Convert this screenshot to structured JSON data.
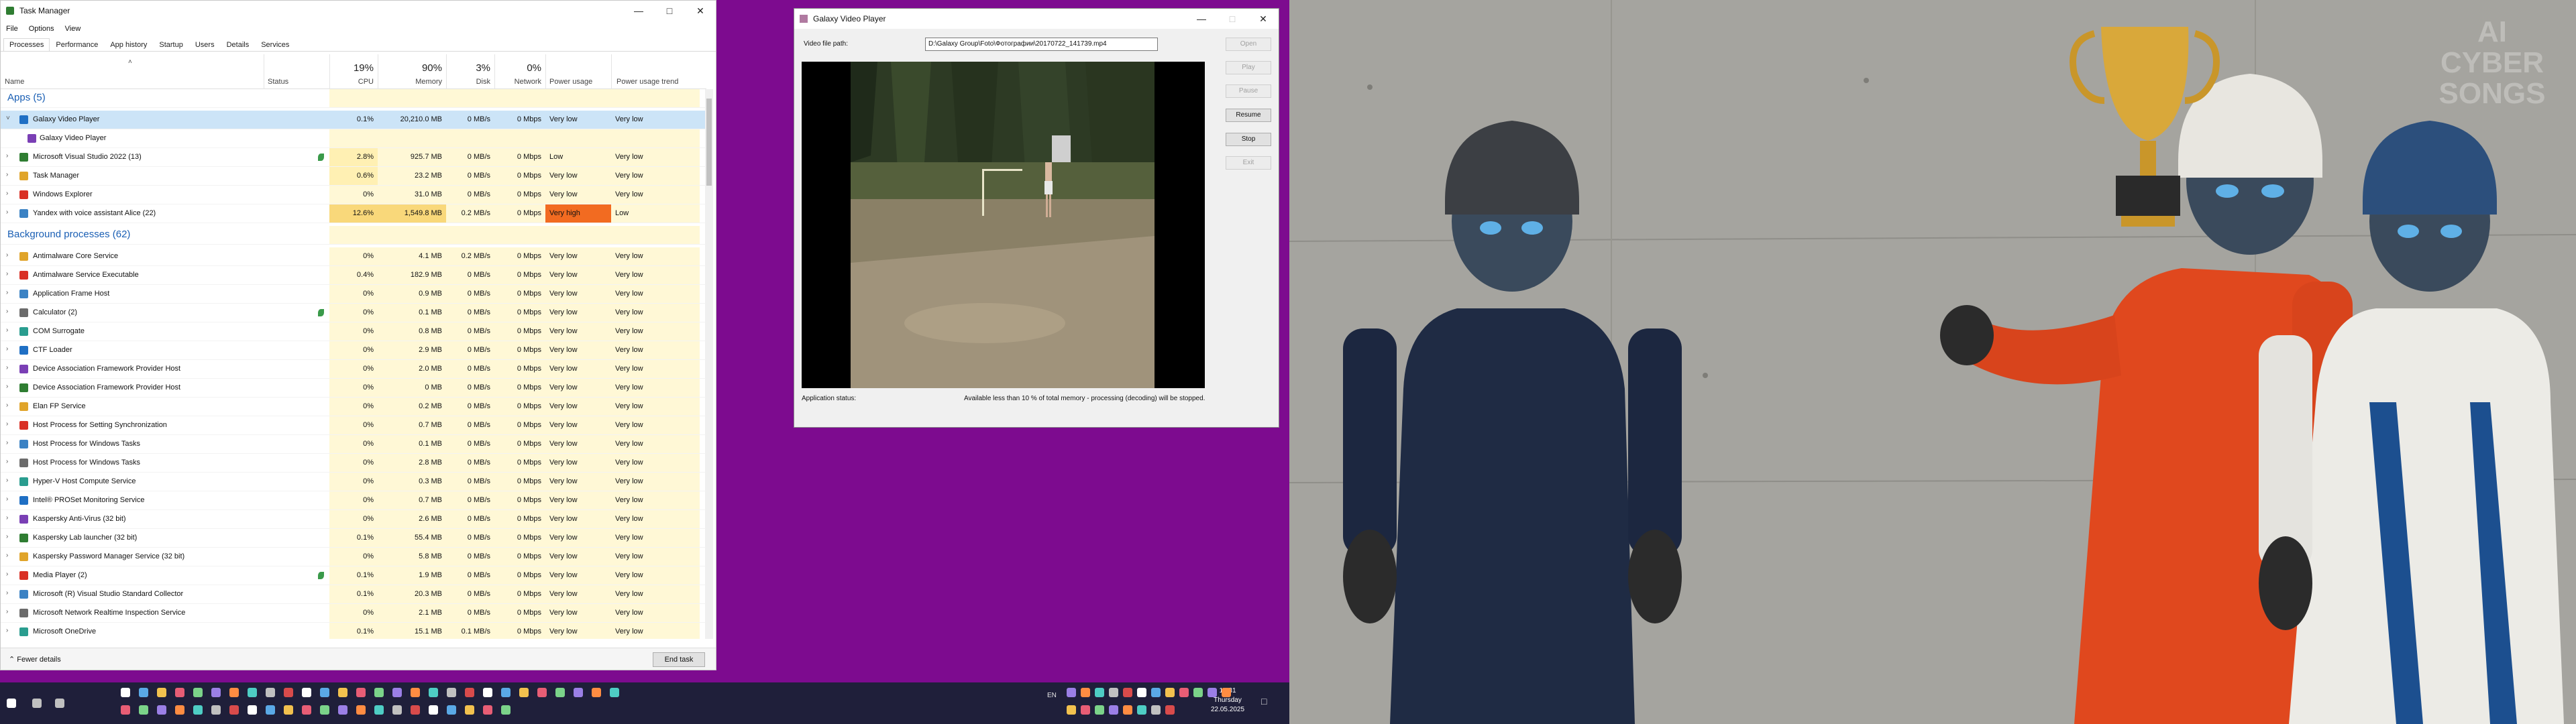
{
  "taskmanager": {
    "title": "Task Manager",
    "menu": [
      "File",
      "Options",
      "View"
    ],
    "tabs": [
      "Processes",
      "Performance",
      "App history",
      "Startup",
      "Users",
      "Details",
      "Services"
    ],
    "columns": {
      "name": "Name",
      "status": "Status",
      "cpu": "CPU",
      "memory": "Memory",
      "disk": "Disk",
      "network": "Network",
      "power": "Power usage",
      "power_trend": "Power usage trend"
    },
    "totals": {
      "cpu": "19%",
      "memory": "90%",
      "disk": "3%",
      "network": "0%"
    },
    "sections": {
      "apps": "Apps (5)",
      "background": "Background processes (62)"
    },
    "apps": [
      {
        "name": "Galaxy Video Player",
        "cpu": "0.1%",
        "memory": "20,210.0 MB",
        "disk": "0 MB/s",
        "network": "0 Mbps",
        "power": "Very low",
        "trend": "Very low"
      },
      {
        "name": "Galaxy Video Player"
      },
      {
        "name": "Microsoft Visual Studio 2022 (13)",
        "cpu": "2.8%",
        "memory": "925.7 MB",
        "disk": "0 MB/s",
        "network": "0 Mbps",
        "power": "Low",
        "trend": "Very low"
      },
      {
        "name": "Task Manager",
        "cpu": "0.6%",
        "memory": "23.2 MB",
        "disk": "0 MB/s",
        "network": "0 Mbps",
        "power": "Very low",
        "trend": "Very low"
      },
      {
        "name": "Windows Explorer",
        "cpu": "0%",
        "memory": "31.0 MB",
        "disk": "0 MB/s",
        "network": "0 Mbps",
        "power": "Very low",
        "trend": "Very low"
      },
      {
        "name": "Yandex with voice assistant Alice (22)",
        "cpu": "12.6%",
        "memory": "1,549.8 MB",
        "disk": "0.2 MB/s",
        "network": "0 Mbps",
        "power": "Very high",
        "trend": "Low"
      }
    ],
    "background": [
      {
        "name": "Antimalware Core Service",
        "cpu": "0%",
        "memory": "4.1 MB",
        "disk": "0.2 MB/s",
        "network": "0 Mbps",
        "power": "Very low",
        "trend": "Very low"
      },
      {
        "name": "Antimalware Service Executable",
        "cpu": "0.4%",
        "memory": "182.9 MB",
        "disk": "0 MB/s",
        "network": "0 Mbps",
        "power": "Very low",
        "trend": "Very low"
      },
      {
        "name": "Application Frame Host",
        "cpu": "0%",
        "memory": "0.9 MB",
        "disk": "0 MB/s",
        "network": "0 Mbps",
        "power": "Very low",
        "trend": "Very low"
      },
      {
        "name": "Calculator (2)",
        "cpu": "0%",
        "memory": "0.1 MB",
        "disk": "0 MB/s",
        "network": "0 Mbps",
        "power": "Very low",
        "trend": "Very low"
      },
      {
        "name": "COM Surrogate",
        "cpu": "0%",
        "memory": "0.8 MB",
        "disk": "0 MB/s",
        "network": "0 Mbps",
        "power": "Very low",
        "trend": "Very low"
      },
      {
        "name": "CTF Loader",
        "cpu": "0%",
        "memory": "2.9 MB",
        "disk": "0 MB/s",
        "network": "0 Mbps",
        "power": "Very low",
        "trend": "Very low"
      },
      {
        "name": "Device Association Framework Provider Host",
        "cpu": "0%",
        "memory": "2.0 MB",
        "disk": "0 MB/s",
        "network": "0 Mbps",
        "power": "Very low",
        "trend": "Very low"
      },
      {
        "name": "Device Association Framework Provider Host",
        "cpu": "0%",
        "memory": "0 MB",
        "disk": "0 MB/s",
        "network": "0 Mbps",
        "power": "Very low",
        "trend": "Very low"
      },
      {
        "name": "Elan FP Service",
        "cpu": "0%",
        "memory": "0.2 MB",
        "disk": "0 MB/s",
        "network": "0 Mbps",
        "power": "Very low",
        "trend": "Very low"
      },
      {
        "name": "Host Process for Setting Synchronization",
        "cpu": "0%",
        "memory": "0.7 MB",
        "disk": "0 MB/s",
        "network": "0 Mbps",
        "power": "Very low",
        "trend": "Very low"
      },
      {
        "name": "Host Process for Windows Tasks",
        "cpu": "0%",
        "memory": "0.1 MB",
        "disk": "0 MB/s",
        "network": "0 Mbps",
        "power": "Very low",
        "trend": "Very low"
      },
      {
        "name": "Host Process for Windows Tasks",
        "cpu": "0%",
        "memory": "2.8 MB",
        "disk": "0 MB/s",
        "network": "0 Mbps",
        "power": "Very low",
        "trend": "Very low"
      },
      {
        "name": "Hyper-V Host Compute Service",
        "cpu": "0%",
        "memory": "0.3 MB",
        "disk": "0 MB/s",
        "network": "0 Mbps",
        "power": "Very low",
        "trend": "Very low"
      },
      {
        "name": "Intel® PROSet Monitoring Service",
        "cpu": "0%",
        "memory": "0.7 MB",
        "disk": "0 MB/s",
        "network": "0 Mbps",
        "power": "Very low",
        "trend": "Very low"
      },
      {
        "name": "Kaspersky Anti-Virus (32 bit)",
        "cpu": "0%",
        "memory": "2.6 MB",
        "disk": "0 MB/s",
        "network": "0 Mbps",
        "power": "Very low",
        "trend": "Very low"
      },
      {
        "name": "Kaspersky Lab launcher (32 bit)",
        "cpu": "0.1%",
        "memory": "55.4 MB",
        "disk": "0 MB/s",
        "network": "0 Mbps",
        "power": "Very low",
        "trend": "Very low"
      },
      {
        "name": "Kaspersky Password Manager Service (32 bit)",
        "cpu": "0%",
        "memory": "5.8 MB",
        "disk": "0 MB/s",
        "network": "0 Mbps",
        "power": "Very low",
        "trend": "Very low"
      },
      {
        "name": "Media Player (2)",
        "cpu": "0.1%",
        "memory": "1.9 MB",
        "disk": "0 MB/s",
        "network": "0 Mbps",
        "power": "Very low",
        "trend": "Very low"
      },
      {
        "name": "Microsoft (R) Visual Studio Standard Collector",
        "cpu": "0.1%",
        "memory": "20.3 MB",
        "disk": "0 MB/s",
        "network": "0 Mbps",
        "power": "Very low",
        "trend": "Very low"
      },
      {
        "name": "Microsoft Network Realtime Inspection Service",
        "cpu": "0%",
        "memory": "2.1 MB",
        "disk": "0 MB/s",
        "network": "0 Mbps",
        "power": "Very low",
        "trend": "Very low"
      },
      {
        "name": "Microsoft OneDrive",
        "cpu": "0.1%",
        "memory": "15.1 MB",
        "disk": "0.1 MB/s",
        "network": "0 Mbps",
        "power": "Very low",
        "trend": "Very low"
      }
    ],
    "fewer_details": "Fewer details",
    "end_task": "End task"
  },
  "player": {
    "title": "Galaxy Video Player",
    "path_label": "Video file path:",
    "path_value": "D:\\Galaxy Group\\Foto\\Фотографии\\20170722_141739.mp4",
    "buttons": {
      "open": "Open",
      "play": "Play",
      "pause": "Pause",
      "resume": "Resume",
      "stop": "Stop",
      "exit": "Exit"
    },
    "status_label": "Application status:",
    "status_message": "Available less than 10 % of total memory - processing (decoding) will be stopped."
  },
  "photo": {
    "watermark": [
      "AI",
      "CYBER",
      "SONGS"
    ]
  },
  "taskbar": {
    "language": "EN",
    "time": "10:31",
    "day": "Thursday",
    "date": "22.05.2025"
  },
  "colors": {
    "cpu_high": "#f9d87a",
    "cpu_mid": "#fff0b3",
    "cpu_low": "#fff8d6",
    "power_high": "#f26b21",
    "selected": "#cce4f7",
    "section": "#1a5fb4",
    "desktop": "#7d0b8f"
  }
}
